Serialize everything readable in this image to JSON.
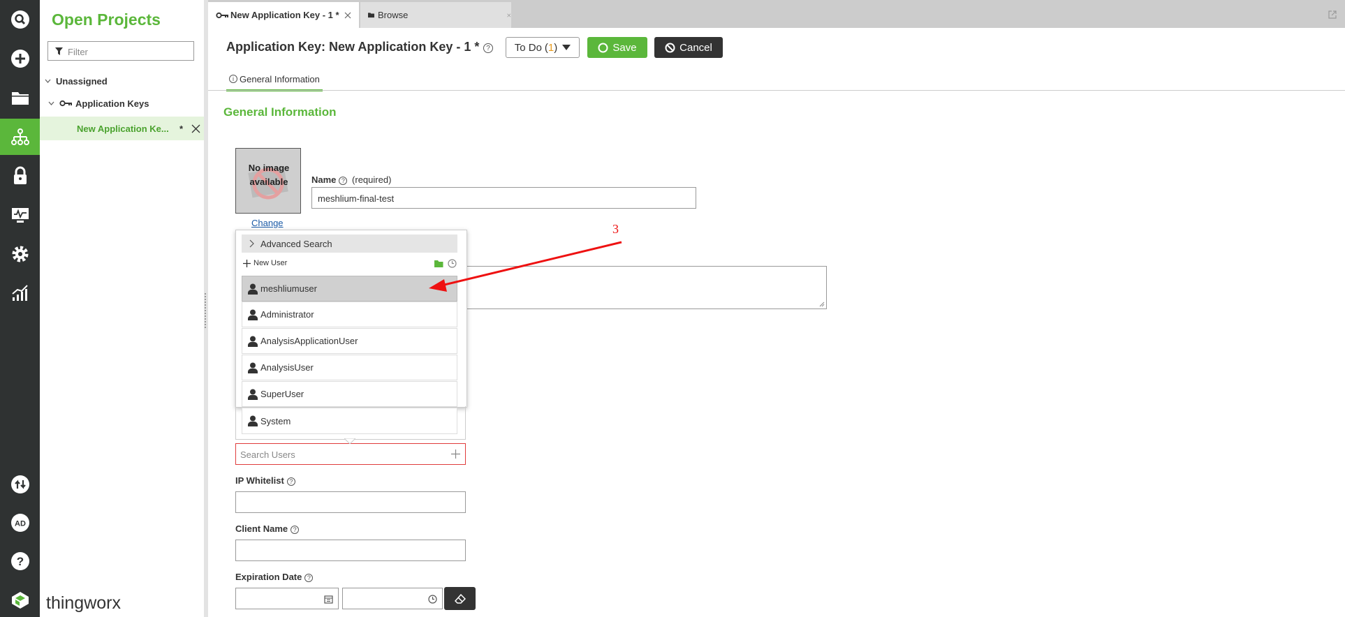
{
  "colors": {
    "accent": "#5bb73b",
    "rail": "#2f3232",
    "danger": "#e8323c",
    "annotation": "#ff0000"
  },
  "rail": {
    "icons": [
      "search-icon",
      "add-icon",
      "folder-icon",
      "hierarchy-icon",
      "lock-icon",
      "monitor-icon",
      "gear-icon",
      "analytics-icon",
      "import-export-icon",
      "ad-icon",
      "help-icon"
    ],
    "brand": "thingworx"
  },
  "projects": {
    "title": "Open Projects",
    "filter_placeholder": "Filter",
    "tree": [
      {
        "label": "Unassigned"
      },
      {
        "label": "Application Keys"
      },
      {
        "label": "New Application Ke...",
        "modified": "*"
      }
    ]
  },
  "tabs": [
    {
      "label": "New Application Key - 1 *",
      "active": true
    },
    {
      "label": "Browse",
      "active": false
    }
  ],
  "header": {
    "title": "Application Key: New Application Key - 1 *",
    "todo_label": "To Do",
    "todo_count": "1",
    "save_label": "Save",
    "cancel_label": "Cancel",
    "subtab": "General Information"
  },
  "form": {
    "section_title": "General Information",
    "no_image_text": "No image available",
    "change_link": "Change",
    "name_label": "Name",
    "name_required": "(required)",
    "name_value": "meshlium-final-test",
    "search_users_placeholder": "Search Users",
    "ip_whitelist_label": "IP Whitelist",
    "client_name_label": "Client Name",
    "expiration_label": "Expiration Date"
  },
  "dropdown": {
    "advanced_search": "Advanced Search",
    "new_user": "New User",
    "users": [
      "meshliumuser",
      "Administrator",
      "AnalysisApplicationUser",
      "AnalysisUser",
      "SuperUser",
      "System"
    ],
    "selected": "meshliumuser"
  },
  "annotation": {
    "label": "3"
  }
}
